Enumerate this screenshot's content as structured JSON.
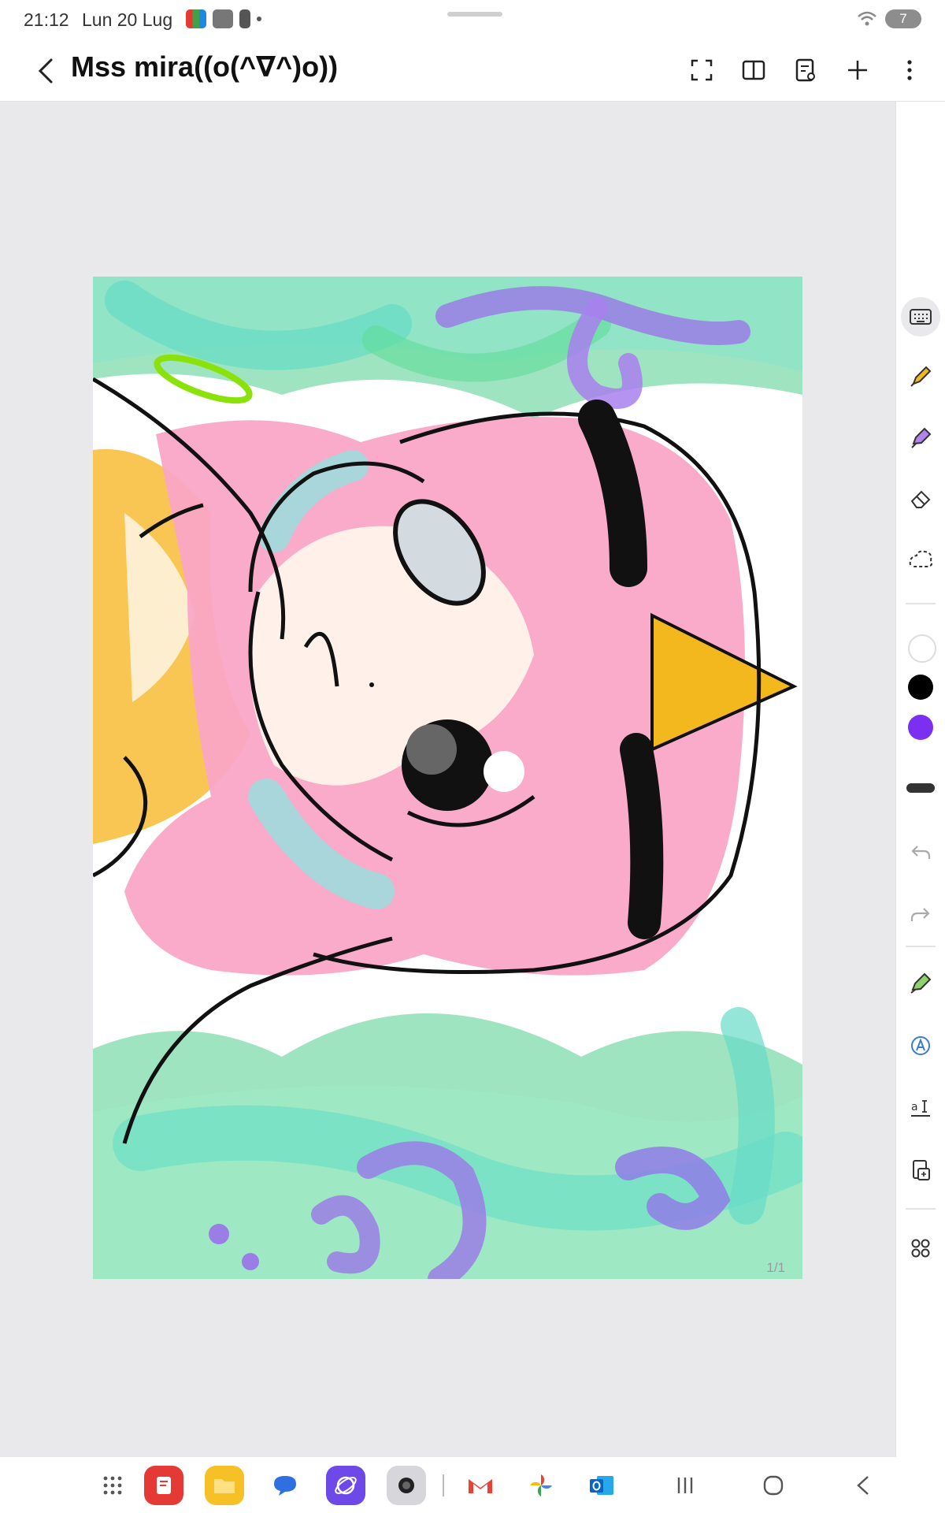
{
  "status": {
    "time": "21:12",
    "date": "Lun 20 Lug",
    "battery": "7"
  },
  "appbar": {
    "title": "Mss mira((o(^∇^)o))"
  },
  "canvas": {
    "page_indicator": "1/1"
  },
  "colors": {
    "accent_purple": "#7b2ff0",
    "pen_yellow": "#f5b81c",
    "pen_purple": "#b184f0",
    "swatch_white": "#ffffff",
    "swatch_black": "#000000",
    "swatch_purple": "#7b2ff0"
  },
  "icons": {
    "toolbar": [
      "fullscreen-icon",
      "book-view-icon",
      "page-settings-icon",
      "add-icon",
      "more-icon"
    ],
    "rightbar": [
      "keyboard-icon",
      "pen-icon",
      "highlighter-icon",
      "eraser-icon",
      "lasso-icon",
      "undo-icon",
      "redo-icon",
      "pen-settings-icon",
      "text-style-icon",
      "text-box-icon",
      "insert-icon",
      "more-tools-icon"
    ],
    "dock": [
      "app-drawer-icon",
      "notes-app-icon",
      "files-app-icon",
      "messages-app-icon",
      "internet-app-icon",
      "camera-app-icon",
      "gmail-app-icon",
      "photos-app-icon",
      "outlook-app-icon"
    ]
  }
}
